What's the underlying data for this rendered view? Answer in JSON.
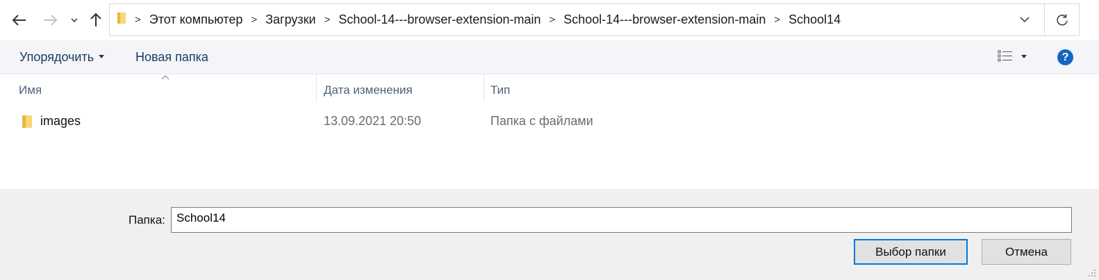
{
  "addressbar": {
    "breadcrumbs": [
      "Этот компьютер",
      "Загрузки",
      "School-14---browser-extension-main",
      "School-14---browser-extension-main",
      "School14"
    ]
  },
  "toolbar": {
    "organize_label": "Упорядочить",
    "new_folder_label": "Новая папка"
  },
  "columns": {
    "name": "Имя",
    "date": "Дата изменения",
    "type": "Тип"
  },
  "rows": [
    {
      "name": "images",
      "date": "13.09.2021 20:50",
      "type": "Папка с файлами"
    }
  ],
  "footer": {
    "folder_label": "Папка:",
    "folder_value": "School14",
    "select_button": "Выбор папки",
    "cancel_button": "Отмена"
  },
  "icons": {
    "back": "arrow-left-icon",
    "forward": "arrow-right-icon",
    "recent": "chevron-down-icon",
    "up": "arrow-up-icon",
    "refresh": "refresh-icon",
    "help": "help-icon",
    "view": "details-view-icon",
    "folder": "folder-icon"
  },
  "colors": {
    "accent": "#0078d7",
    "help": "#1565c0",
    "folder": "#f8d775",
    "toolbar_bg": "#f3f5f8",
    "footer_bg": "#f0f0f0"
  }
}
